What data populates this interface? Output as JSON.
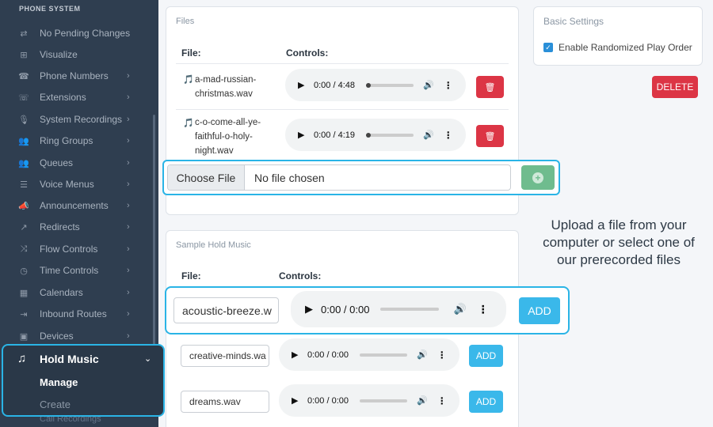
{
  "sidebar": {
    "header": "PHONE SYSTEM",
    "items": [
      {
        "label": "No Pending Changes",
        "icon": "sync-icon",
        "glyph": "⇄",
        "chevron": false
      },
      {
        "label": "Visualize",
        "icon": "sitemap-icon",
        "glyph": "⊞",
        "chevron": false
      },
      {
        "label": "Phone Numbers",
        "icon": "phone-icon",
        "glyph": "☎",
        "chevron": true
      },
      {
        "label": "Extensions",
        "icon": "phone-extension-icon",
        "glyph": "☏",
        "chevron": true
      },
      {
        "label": "System Recordings",
        "icon": "microphone-icon",
        "glyph": "🎙",
        "chevron": true
      },
      {
        "label": "Ring Groups",
        "icon": "users-icon",
        "glyph": "👥",
        "chevron": true
      },
      {
        "label": "Queues",
        "icon": "group-icon",
        "glyph": "👥",
        "chevron": true
      },
      {
        "label": "Voice Menus",
        "icon": "list-icon",
        "glyph": "☰",
        "chevron": true
      },
      {
        "label": "Announcements",
        "icon": "megaphone-icon",
        "glyph": "📣",
        "chevron": true
      },
      {
        "label": "Redirects",
        "icon": "redirect-icon",
        "glyph": "↗",
        "chevron": true
      },
      {
        "label": "Flow Controls",
        "icon": "flow-icon",
        "glyph": "⤨",
        "chevron": true
      },
      {
        "label": "Time Controls",
        "icon": "clock-icon",
        "glyph": "◷",
        "chevron": true
      },
      {
        "label": "Calendars",
        "icon": "calendar-icon",
        "glyph": "▦",
        "chevron": true
      },
      {
        "label": "Inbound Routes",
        "icon": "route-icon",
        "glyph": "⇥",
        "chevron": true
      },
      {
        "label": "Devices",
        "icon": "device-icon",
        "glyph": "▣",
        "chevron": true
      }
    ],
    "hold_music": {
      "label": "Hold Music",
      "manage": "Manage",
      "create": "Create"
    },
    "call_recordings": "Call Recordings"
  },
  "files_card": {
    "title": "Files",
    "col_file": "File:",
    "col_controls": "Controls:",
    "rows": [
      {
        "name_lines": [
          "a-mad-russian-",
          "christmas.wav"
        ],
        "time": "0:00 / 4:48"
      },
      {
        "name_lines": [
          "c-o-come-all-ye-",
          "faithful-o-holy-",
          "night.wav"
        ],
        "time": "0:00 / 4:19"
      }
    ],
    "upload": {
      "choose": "Choose File",
      "no_file": "No file chosen"
    }
  },
  "sample_card": {
    "title": "Sample Hold Music",
    "col_file": "File:",
    "col_controls": "Controls:",
    "rows": [
      {
        "name": "acoustic-breeze.w",
        "time": "0:00 / 0:00",
        "add": "ADD"
      },
      {
        "name": "creative-minds.wa",
        "time": "0:00 / 0:00",
        "add": "ADD"
      },
      {
        "name": "dreams.wav",
        "time": "0:00 / 0:00",
        "add": "ADD"
      }
    ]
  },
  "basic_settings": {
    "title": "Basic Settings",
    "checkbox_label": "Enable Randomized Play Order",
    "checked": true,
    "delete": "DELETE"
  },
  "callout": "Upload a file from your computer or select one of our prerecorded files",
  "colors": {
    "sidebar_bg": "#2f3e50",
    "highlight": "#2ab4e6",
    "danger": "#dc3545",
    "add": "#3ab8ea",
    "upload": "#6fbc8e"
  }
}
